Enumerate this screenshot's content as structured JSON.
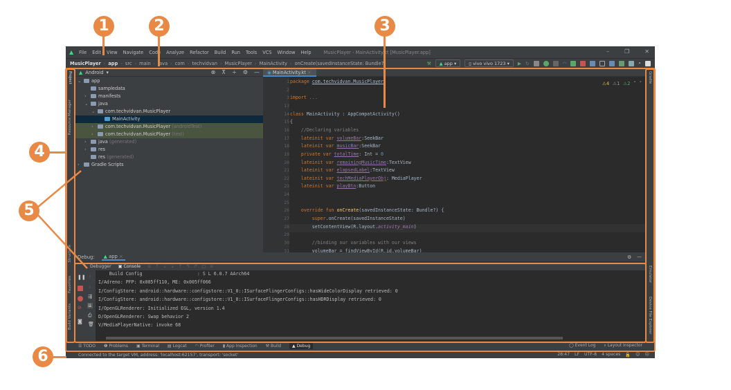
{
  "menu": {
    "items": [
      "File",
      "Edit",
      "View",
      "Navigate",
      "Code",
      "Analyze",
      "Refactor",
      "Build",
      "Run",
      "Tools",
      "VCS",
      "Window",
      "Help"
    ],
    "window_title": "MusicPlayer - MainActivity.kt [MusicPlayer.app]"
  },
  "breadcrumb": [
    "MusicPlayer",
    "app",
    "src",
    "main",
    "java",
    "com",
    "techvidvan",
    "MusicPlayer",
    "MainActivity",
    "onCreate(savedInstanceState: Bundle?)"
  ],
  "toolbar": {
    "run_config": "app",
    "device": "vivo vivo 1723"
  },
  "left_strip": [
    "Project",
    "Resource Manager",
    "Structure",
    "Favorites",
    "Build Variants"
  ],
  "right_strip": [
    "Gradle",
    "Emulator",
    "Device File Explorer"
  ],
  "project": {
    "view": "Android",
    "tree": [
      {
        "label": "app",
        "suffix": "",
        "depth": 0,
        "arrow": "v"
      },
      {
        "label": "sampledata",
        "suffix": "",
        "depth": 1,
        "arrow": ""
      },
      {
        "label": "manifests",
        "suffix": "",
        "depth": 1,
        "arrow": ">"
      },
      {
        "label": "java",
        "suffix": "",
        "depth": 1,
        "arrow": "v"
      },
      {
        "label": "com.techvidvan.MusicPlayer",
        "suffix": "",
        "depth": 2,
        "arrow": "v"
      },
      {
        "label": "MainActivity",
        "suffix": "",
        "depth": 3,
        "arrow": "",
        "selected": true
      },
      {
        "label": "com.techvidvan.MusicPlayer",
        "suffix": "(androidTest)",
        "depth": 2,
        "arrow": ">",
        "test": true
      },
      {
        "label": "com.techvidvan.MusicPlayer",
        "suffix": "(test)",
        "depth": 2,
        "arrow": ">",
        "test": true
      },
      {
        "label": "java",
        "suffix": "(generated)",
        "depth": 1,
        "arrow": ">"
      },
      {
        "label": "res",
        "suffix": "",
        "depth": 1,
        "arrow": ">"
      },
      {
        "label": "res",
        "suffix": "(generated)",
        "depth": 1,
        "arrow": ""
      },
      {
        "label": "Gradle Scripts",
        "suffix": "",
        "depth": 0,
        "arrow": ">"
      }
    ]
  },
  "editor": {
    "tab": "MainActivity.kt",
    "inspections": {
      "warnings": "4",
      "weak_warnings": "1",
      "typos": "2"
    },
    "line_numbers": [
      "1",
      "2",
      "3",
      "13",
      "14",
      "15",
      "16",
      "17",
      "18",
      "19",
      "20",
      "21",
      "22",
      "23",
      "24",
      "25",
      "26",
      "27",
      "28",
      "29",
      "30",
      "31"
    ],
    "lines": [
      [
        [
          "package ",
          "k"
        ],
        [
          "com.techvidvan.MusicPlayer",
          "u"
        ]
      ],
      [],
      [
        [
          "import ",
          "k"
        ],
        [
          "...",
          "c"
        ]
      ],
      [],
      [
        [
          "class ",
          "k"
        ],
        [
          "MainActivity : AppCompatActivity()",
          ""
        ]
      ],
      [
        [
          "{",
          ""
        ]
      ],
      [
        [
          "    //Declaring variables",
          "c"
        ]
      ],
      [
        [
          "    lateinit var ",
          "k"
        ],
        [
          "volumeBar",
          "f"
        ],
        [
          ":SeekBar",
          ""
        ]
      ],
      [
        [
          "    lateinit var ",
          "k"
        ],
        [
          "musicBar",
          "f"
        ],
        [
          ":SeekBar",
          ""
        ]
      ],
      [
        [
          "    private var ",
          "k"
        ],
        [
          "totalTime",
          "f"
        ],
        [
          ": Int = ",
          ""
        ],
        [
          "0",
          "n"
        ]
      ],
      [
        [
          "    lateinit var ",
          "k"
        ],
        [
          "remainingMusicTime",
          "f"
        ],
        [
          ":TextView",
          ""
        ]
      ],
      [
        [
          "    lateinit var ",
          "k"
        ],
        [
          "elapsedLabel",
          "f"
        ],
        [
          ":TextView",
          ""
        ]
      ],
      [
        [
          "    lateinit var ",
          "k"
        ],
        [
          "techMediaPlayerObj",
          "f"
        ],
        [
          ": MediaPlayer",
          ""
        ]
      ],
      [
        [
          "    lateinit var ",
          "k"
        ],
        [
          "playBtn",
          "f"
        ],
        [
          ":Button",
          ""
        ]
      ],
      [],
      [],
      [
        [
          "    override fun ",
          "k"
        ],
        [
          "onCreate",
          "d"
        ],
        [
          "(savedInstanceState: Bundle?) {",
          ""
        ]
      ],
      [
        [
          "        super",
          "k"
        ],
        [
          ".onCreate(savedInstanceState)",
          ""
        ]
      ],
      [
        [
          "        setContentView(R.layout.",
          ""
        ],
        [
          "activity_main",
          "p"
        ],
        [
          ")",
          ""
        ]
      ],
      [],
      [
        [
          "        //binding our variables with our views",
          "c"
        ]
      ],
      [
        [
          "        volumeBar = findViewById(R.id.volumeBar)",
          ""
        ]
      ]
    ]
  },
  "debug": {
    "label": "Debug:",
    "config": "app",
    "tabs": [
      "Debugger",
      "Console"
    ],
    "console": [
      "    Build Config                    : S L 6.0.7 AArch64",
      "I/Adreno: PFP: 0x005ff110, ME: 0x005ff066",
      "I/ConfigStore: android::hardware::configstore::V1_0::ISurfaceFlingerConfigs::hasWideColorDisplay retrieved: 0",
      "I/ConfigStore: android::hardware::configstore::V1_0::ISurfaceFlingerConfigs::hasHDRDisplay retrieved: 0",
      "I/OpenGLRenderer: Initialized EGL, version 1.4",
      "D/OpenGLRenderer: Swap behavior 2",
      "V/MediaPlayerNative: invoke 68"
    ]
  },
  "bottom_tools": [
    "TODO",
    "Problems",
    "Terminal",
    "Logcat",
    "Profiler",
    "App Inspection",
    "Build",
    "Debug"
  ],
  "bottom_tools_right": [
    "Event Log",
    "Layout Inspector"
  ],
  "status": {
    "message": "Connected to the target VM, address: 'localhost:62157', transport: 'socket'",
    "position": "28:47",
    "line_sep": "LF",
    "encoding": "UTF-8",
    "indent": "4 spaces"
  },
  "annotations": [
    "1",
    "2",
    "3",
    "4",
    "5",
    "6"
  ],
  "colors": {
    "annotation": "#e88945",
    "accent": "#4a88c7",
    "background": "#2b2b2b"
  }
}
